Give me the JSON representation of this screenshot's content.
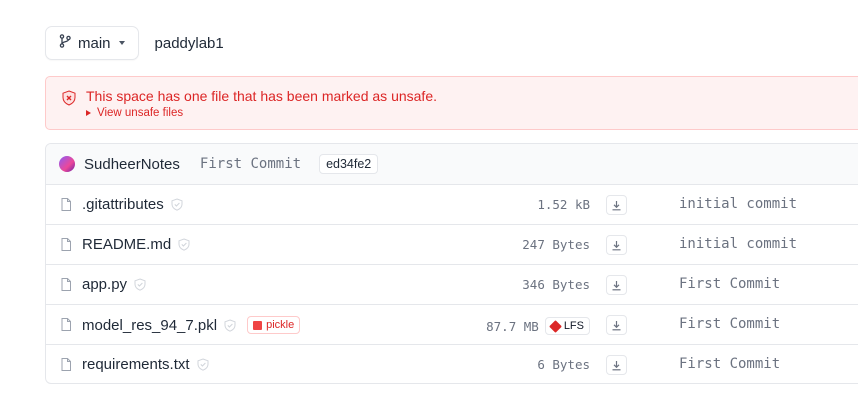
{
  "branch": {
    "icon": "git-branch-icon",
    "name": "main",
    "caret": "chevron-down-icon"
  },
  "repo": {
    "name": "paddylab1"
  },
  "alert": {
    "icon": "shield-x-icon",
    "message": "This space has one file that has been marked as unsafe.",
    "toggle_label": "View unsafe files",
    "color": "#dc2626"
  },
  "commit_header": {
    "author": "SudheerNotes",
    "message": "First Commit",
    "hash": "ed34fe2"
  },
  "files": [
    {
      "name": ".gitattributes",
      "size": "1.52 kB",
      "commit": "initial commit",
      "pickle": "",
      "lfs": ""
    },
    {
      "name": "README.md",
      "size": "247 Bytes",
      "commit": "initial commit",
      "pickle": "",
      "lfs": ""
    },
    {
      "name": "app.py",
      "size": "346 Bytes",
      "commit": "First Commit",
      "pickle": "",
      "lfs": ""
    },
    {
      "name": "model_res_94_7.pkl",
      "size": "87.7 MB",
      "commit": "First Commit",
      "pickle": "pickle",
      "lfs": "LFS"
    },
    {
      "name": "requirements.txt",
      "size": "6 Bytes",
      "commit": "First Commit",
      "pickle": "",
      "lfs": ""
    }
  ]
}
